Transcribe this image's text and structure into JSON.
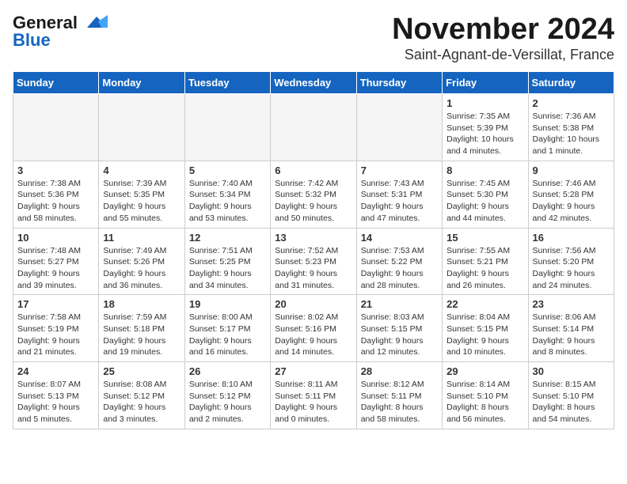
{
  "header": {
    "logo_line1": "General",
    "logo_line2": "Blue",
    "month": "November 2024",
    "location": "Saint-Agnant-de-Versillat, France"
  },
  "weekdays": [
    "Sunday",
    "Monday",
    "Tuesday",
    "Wednesday",
    "Thursday",
    "Friday",
    "Saturday"
  ],
  "weeks": [
    [
      {
        "day": "",
        "empty": true
      },
      {
        "day": "",
        "empty": true
      },
      {
        "day": "",
        "empty": true
      },
      {
        "day": "",
        "empty": true
      },
      {
        "day": "",
        "empty": true
      },
      {
        "day": "1",
        "sunrise": "Sunrise: 7:35 AM",
        "sunset": "Sunset: 5:39 PM",
        "daylight": "Daylight: 10 hours and 4 minutes."
      },
      {
        "day": "2",
        "sunrise": "Sunrise: 7:36 AM",
        "sunset": "Sunset: 5:38 PM",
        "daylight": "Daylight: 10 hours and 1 minute."
      }
    ],
    [
      {
        "day": "3",
        "sunrise": "Sunrise: 7:38 AM",
        "sunset": "Sunset: 5:36 PM",
        "daylight": "Daylight: 9 hours and 58 minutes."
      },
      {
        "day": "4",
        "sunrise": "Sunrise: 7:39 AM",
        "sunset": "Sunset: 5:35 PM",
        "daylight": "Daylight: 9 hours and 55 minutes."
      },
      {
        "day": "5",
        "sunrise": "Sunrise: 7:40 AM",
        "sunset": "Sunset: 5:34 PM",
        "daylight": "Daylight: 9 hours and 53 minutes."
      },
      {
        "day": "6",
        "sunrise": "Sunrise: 7:42 AM",
        "sunset": "Sunset: 5:32 PM",
        "daylight": "Daylight: 9 hours and 50 minutes."
      },
      {
        "day": "7",
        "sunrise": "Sunrise: 7:43 AM",
        "sunset": "Sunset: 5:31 PM",
        "daylight": "Daylight: 9 hours and 47 minutes."
      },
      {
        "day": "8",
        "sunrise": "Sunrise: 7:45 AM",
        "sunset": "Sunset: 5:30 PM",
        "daylight": "Daylight: 9 hours and 44 minutes."
      },
      {
        "day": "9",
        "sunrise": "Sunrise: 7:46 AM",
        "sunset": "Sunset: 5:28 PM",
        "daylight": "Daylight: 9 hours and 42 minutes."
      }
    ],
    [
      {
        "day": "10",
        "sunrise": "Sunrise: 7:48 AM",
        "sunset": "Sunset: 5:27 PM",
        "daylight": "Daylight: 9 hours and 39 minutes."
      },
      {
        "day": "11",
        "sunrise": "Sunrise: 7:49 AM",
        "sunset": "Sunset: 5:26 PM",
        "daylight": "Daylight: 9 hours and 36 minutes."
      },
      {
        "day": "12",
        "sunrise": "Sunrise: 7:51 AM",
        "sunset": "Sunset: 5:25 PM",
        "daylight": "Daylight: 9 hours and 34 minutes."
      },
      {
        "day": "13",
        "sunrise": "Sunrise: 7:52 AM",
        "sunset": "Sunset: 5:23 PM",
        "daylight": "Daylight: 9 hours and 31 minutes."
      },
      {
        "day": "14",
        "sunrise": "Sunrise: 7:53 AM",
        "sunset": "Sunset: 5:22 PM",
        "daylight": "Daylight: 9 hours and 28 minutes."
      },
      {
        "day": "15",
        "sunrise": "Sunrise: 7:55 AM",
        "sunset": "Sunset: 5:21 PM",
        "daylight": "Daylight: 9 hours and 26 minutes."
      },
      {
        "day": "16",
        "sunrise": "Sunrise: 7:56 AM",
        "sunset": "Sunset: 5:20 PM",
        "daylight": "Daylight: 9 hours and 24 minutes."
      }
    ],
    [
      {
        "day": "17",
        "sunrise": "Sunrise: 7:58 AM",
        "sunset": "Sunset: 5:19 PM",
        "daylight": "Daylight: 9 hours and 21 minutes."
      },
      {
        "day": "18",
        "sunrise": "Sunrise: 7:59 AM",
        "sunset": "Sunset: 5:18 PM",
        "daylight": "Daylight: 9 hours and 19 minutes."
      },
      {
        "day": "19",
        "sunrise": "Sunrise: 8:00 AM",
        "sunset": "Sunset: 5:17 PM",
        "daylight": "Daylight: 9 hours and 16 minutes."
      },
      {
        "day": "20",
        "sunrise": "Sunrise: 8:02 AM",
        "sunset": "Sunset: 5:16 PM",
        "daylight": "Daylight: 9 hours and 14 minutes."
      },
      {
        "day": "21",
        "sunrise": "Sunrise: 8:03 AM",
        "sunset": "Sunset: 5:15 PM",
        "daylight": "Daylight: 9 hours and 12 minutes."
      },
      {
        "day": "22",
        "sunrise": "Sunrise: 8:04 AM",
        "sunset": "Sunset: 5:15 PM",
        "daylight": "Daylight: 9 hours and 10 minutes."
      },
      {
        "day": "23",
        "sunrise": "Sunrise: 8:06 AM",
        "sunset": "Sunset: 5:14 PM",
        "daylight": "Daylight: 9 hours and 8 minutes."
      }
    ],
    [
      {
        "day": "24",
        "sunrise": "Sunrise: 8:07 AM",
        "sunset": "Sunset: 5:13 PM",
        "daylight": "Daylight: 9 hours and 5 minutes."
      },
      {
        "day": "25",
        "sunrise": "Sunrise: 8:08 AM",
        "sunset": "Sunset: 5:12 PM",
        "daylight": "Daylight: 9 hours and 3 minutes."
      },
      {
        "day": "26",
        "sunrise": "Sunrise: 8:10 AM",
        "sunset": "Sunset: 5:12 PM",
        "daylight": "Daylight: 9 hours and 2 minutes."
      },
      {
        "day": "27",
        "sunrise": "Sunrise: 8:11 AM",
        "sunset": "Sunset: 5:11 PM",
        "daylight": "Daylight: 9 hours and 0 minutes."
      },
      {
        "day": "28",
        "sunrise": "Sunrise: 8:12 AM",
        "sunset": "Sunset: 5:11 PM",
        "daylight": "Daylight: 8 hours and 58 minutes."
      },
      {
        "day": "29",
        "sunrise": "Sunrise: 8:14 AM",
        "sunset": "Sunset: 5:10 PM",
        "daylight": "Daylight: 8 hours and 56 minutes."
      },
      {
        "day": "30",
        "sunrise": "Sunrise: 8:15 AM",
        "sunset": "Sunset: 5:10 PM",
        "daylight": "Daylight: 8 hours and 54 minutes."
      }
    ]
  ]
}
